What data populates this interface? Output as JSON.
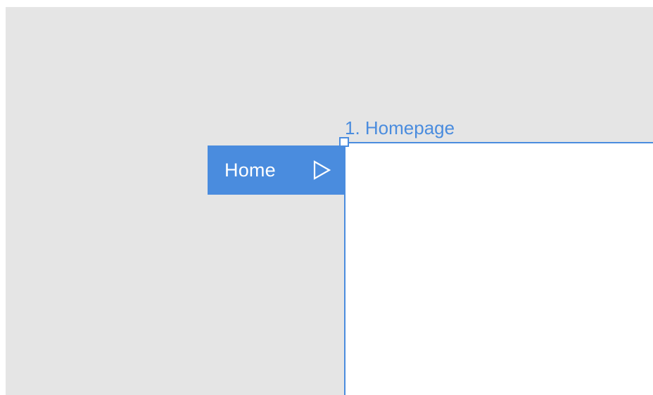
{
  "artboard": {
    "title": "1. Homepage"
  },
  "flow_start": {
    "label": "Home",
    "icon": "play-outline-icon"
  },
  "colors": {
    "accent": "#4a8cde",
    "canvas": "#e5e5e5",
    "artboard_fill": "#ffffff"
  }
}
